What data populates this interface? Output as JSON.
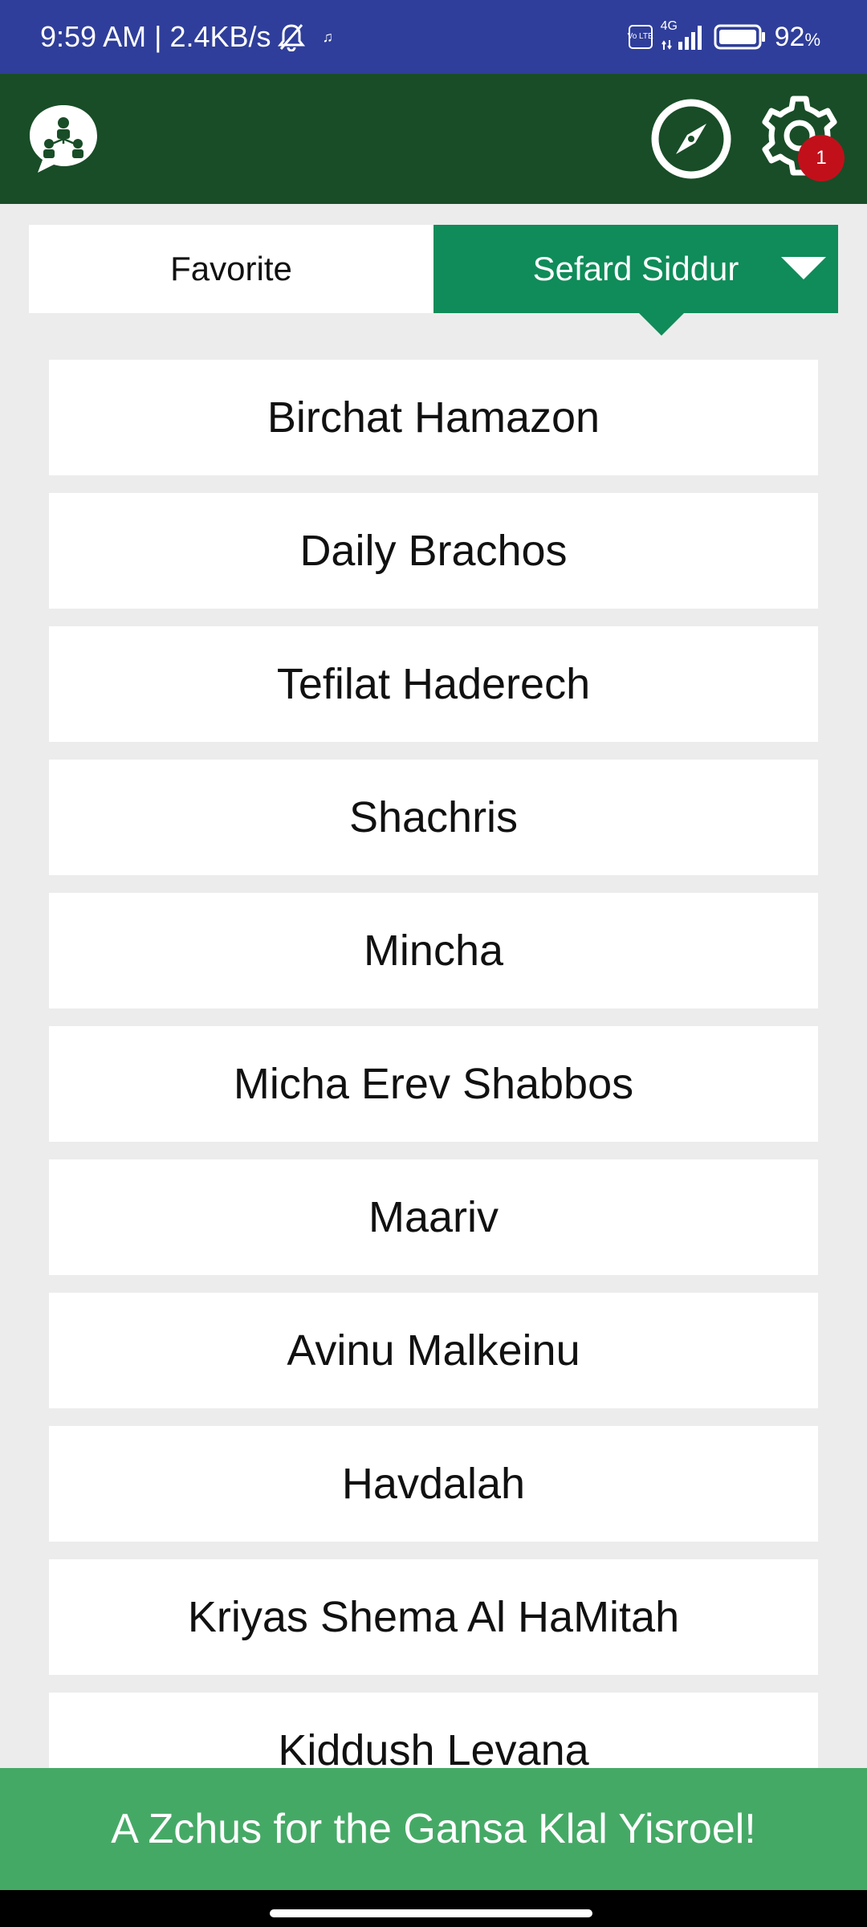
{
  "status_bar": {
    "time": "9:59 AM",
    "separator": "|",
    "speed": "2.4KB/s",
    "mute_icon": "bell-off-icon",
    "music_icon": "music-note-icon",
    "volte_label": "Vo LTE",
    "network_label": "4G",
    "battery_percent": "92",
    "battery_unit": "%"
  },
  "header": {
    "logo_icon": "community-people-icon",
    "compass_icon": "compass-icon",
    "settings_icon": "gear-icon",
    "settings_badge": "1"
  },
  "tabs": {
    "favorite_label": "Favorite",
    "siddur_label": "Sefard Siddur"
  },
  "prayers": [
    {
      "label": "Birchat Hamazon"
    },
    {
      "label": "Daily Brachos"
    },
    {
      "label": "Tefilat Haderech"
    },
    {
      "label": "Shachris"
    },
    {
      "label": "Mincha"
    },
    {
      "label": "Micha Erev Shabbos"
    },
    {
      "label": "Maariv"
    },
    {
      "label": "Avinu Malkeinu"
    },
    {
      "label": "Havdalah"
    },
    {
      "label": "Kriyas Shema Al HaMitah"
    },
    {
      "label": "Kiddush Levana"
    }
  ],
  "footer": {
    "banner_text": "A Zchus for the Gansa Klal Yisroel!"
  },
  "colors": {
    "status_bar": "#2f3e9a",
    "header": "#184d27",
    "active_tab": "#0f8c59",
    "footer": "#45a966",
    "badge": "#c2101b"
  }
}
